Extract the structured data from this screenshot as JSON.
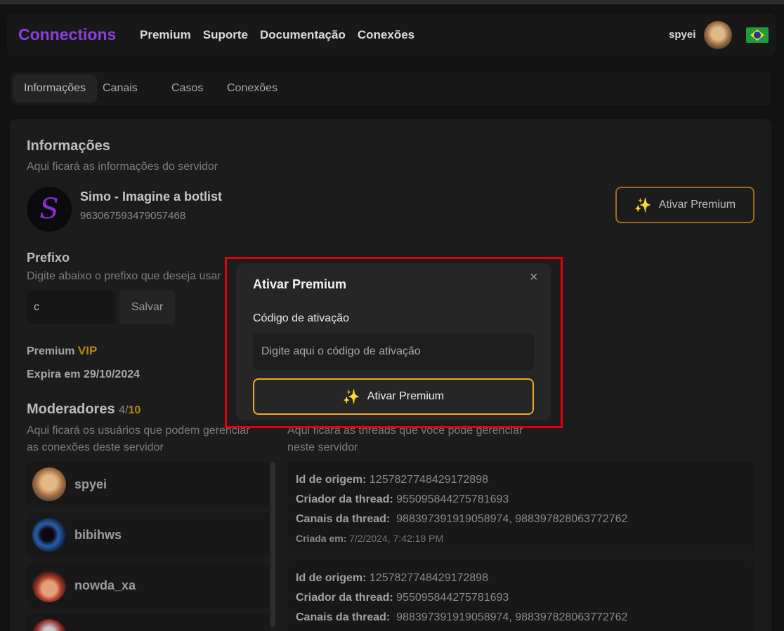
{
  "navbar": {
    "brand": "Connections",
    "links": [
      "Premium",
      "Suporte",
      "Documentação",
      "Conexões"
    ],
    "username": "spyei"
  },
  "tabs": [
    "Informações",
    "Canais",
    "Casos",
    "Conexões"
  ],
  "info": {
    "title": "Informações",
    "description": "Aqui ficará as informações do servidor",
    "server_icon_letter": "S",
    "server_name": "Simo - Imagine a botlist",
    "server_id": "963067593479057468",
    "premium_button": "Ativar Premium"
  },
  "prefix": {
    "title": "Prefixo",
    "description": "Digite abaixo o prefixo que deseja usar",
    "value": "c",
    "save_label": "Salvar"
  },
  "premium_status": {
    "label": "Premium",
    "tier": "VIP",
    "expires": "Expira em 29/10/2024"
  },
  "moderators": {
    "title": "Moderadores",
    "count": "4",
    "separator": "/",
    "max": "10",
    "description_line1": "Aqui ficará os usuários que podem gerenciar",
    "description_line2": "as conexões deste servidor",
    "items": [
      "spyei",
      "bibihws",
      "nowda_xa"
    ]
  },
  "threads": {
    "description_line1": "Aqui ficará as threads que você pode gerenciar",
    "description_line2": "neste servidor",
    "labels": {
      "origin": "Id de origem:",
      "creator": "Criador da thread:",
      "channels": "Canais da thread:",
      "created": "Criada em:"
    },
    "items": [
      {
        "origin": "1257827748429172898",
        "creator": "955095844275781693",
        "channels": "988397391919058974, 988397828063772762",
        "created": "7/2/2024, 7:42:18 PM"
      },
      {
        "origin": "1257827748429172898",
        "creator": "955095844275781693",
        "channels": "988397391919058974, 988397828063772762"
      }
    ]
  },
  "modal": {
    "title": "Ativar Premium",
    "close": "×",
    "label": "Código de ativação",
    "placeholder": "Digite aqui o código de ativação",
    "button": "Ativar Premium",
    "highlight_color": "#e3000b",
    "accent_color": "#f0a830"
  }
}
